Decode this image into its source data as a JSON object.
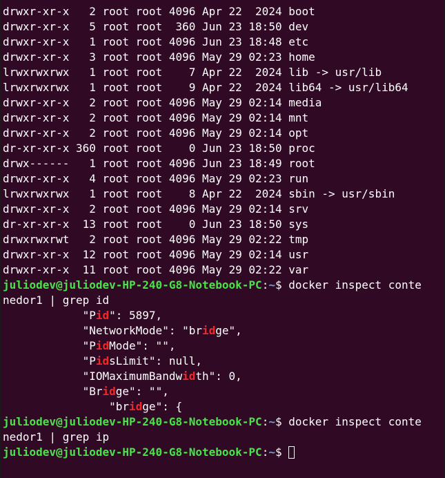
{
  "terminal": {
    "listing": [
      "drwxr-xr-x   2 root root 4096 Apr 22  2024 boot",
      "drwxr-xr-x   5 root root  360 Jun 23 18:50 dev",
      "drwxr-xr-x   1 root root 4096 Jun 23 18:48 etc",
      "drwxr-xr-x   3 root root 4096 May 29 02:23 home",
      "lrwxrwxrwx   1 root root    7 Apr 22  2024 lib -> usr/lib",
      "lrwxrwxrwx   1 root root    9 Apr 22  2024 lib64 -> usr/lib64",
      "drwxr-xr-x   2 root root 4096 May 29 02:14 media",
      "drwxr-xr-x   2 root root 4096 May 29 02:14 mnt",
      "drwxr-xr-x   2 root root 4096 May 29 02:14 opt",
      "dr-xr-xr-x 360 root root    0 Jun 23 18:50 proc",
      "drwx------   1 root root 4096 Jun 23 18:49 root",
      "drwxr-xr-x   4 root root 4096 May 29 02:23 run",
      "lrwxrwxrwx   1 root root    8 Apr 22  2024 sbin -> usr/sbin",
      "drwxr-xr-x   2 root root 4096 May 29 02:14 srv",
      "dr-xr-xr-x  13 root root    0 Jun 23 18:50 sys",
      "drwxrwxrwt   2 root root 4096 May 29 02:22 tmp",
      "drwxr-xr-x  12 root root 4096 May 29 02:14 usr",
      "drwxr-xr-x  11 root root 4096 May 29 02:22 var"
    ],
    "prompt": {
      "user_host": "juliodev@juliodev-HP-240-G8-Notebook-PC",
      "colon": ":",
      "path": "~",
      "dollar": "$ "
    },
    "command1": {
      "line1": "docker inspect conte",
      "line2": "nedor1 | grep id"
    },
    "grep_id_output": [
      {
        "pre": "            \"P",
        "match": "id",
        "post": "\": 5897,"
      },
      {
        "pre": "            \"NetworkMode\": \"br",
        "match": "id",
        "post": "ge\","
      },
      {
        "pre": "            \"P",
        "match": "id",
        "post": "Mode\": \"\","
      },
      {
        "pre": "            \"P",
        "match": "id",
        "post": "sLimit\": null,"
      },
      {
        "pre": "            \"IOMaximumBandw",
        "match": "id",
        "post": "th\": 0,"
      },
      {
        "pre": "            \"Br",
        "match": "id",
        "post": "ge\": \"\","
      },
      {
        "pre": "                \"br",
        "match": "id",
        "post": "ge\": {"
      }
    ],
    "command2": {
      "line1": "docker inspect conte",
      "line2": "nedor1 | grep ip"
    }
  }
}
